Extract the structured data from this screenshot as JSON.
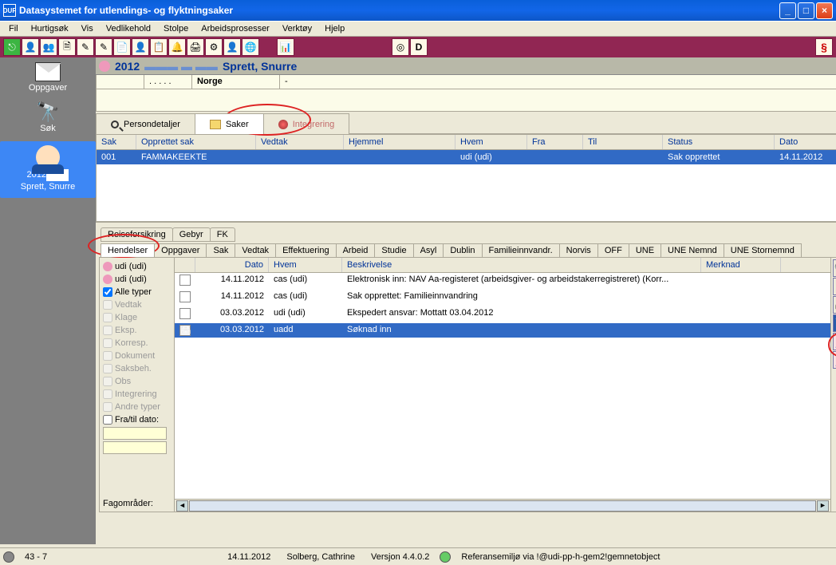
{
  "window": {
    "title": "Datasystemet for utlendings- og flyktningsaker",
    "minimize": "_",
    "maximize": "□",
    "close": "×"
  },
  "menu": {
    "fil": "Fil",
    "hurtigsok": "Hurtigsøk",
    "vis": "Vis",
    "vedlikehold": "Vedlikehold",
    "stolpe": "Stolpe",
    "arbeidsprosesser": "Arbeidsprosesser",
    "verktoy": "Verktøy",
    "hjelp": "Hjelp"
  },
  "toolbar_section": "§",
  "sidebar": {
    "oppgaver": "Oppgaver",
    "sok": "Søk",
    "card_prefix": "2012",
    "card_name": "Sprett, Snurre"
  },
  "header": {
    "title_name": "Sprett, Snurre",
    "title_year": "2012",
    "country": "Norge",
    "dash": "-"
  },
  "bigtabs": {
    "persondetaljer": "Persondetaljer",
    "saker": "Saker",
    "integrering": "Integrering"
  },
  "case_columns": {
    "sak": "Sak",
    "opprettet": "Opprettet sak",
    "vedtak": "Vedtak",
    "hjemmel": "Hjemmel",
    "hvem": "Hvem",
    "fra": "Fra",
    "til": "Til",
    "status": "Status",
    "dato": "Dato"
  },
  "case_row": {
    "sak": "001",
    "opprettet": "FAMMAKEEKTE",
    "vedtak": "",
    "hjemmel": "",
    "hvem": "udi (udi)",
    "fra": "",
    "til": "",
    "status": "Sak opprettet",
    "dato": "14.11.2012"
  },
  "subtabs1": {
    "reiseforsikring": "Reiseforsikring",
    "gebyr": "Gebyr",
    "fk": "FK"
  },
  "subtabs2": {
    "hendelser": "Hendelser",
    "oppgaver": "Oppgaver",
    "sak": "Sak",
    "vedtak": "Vedtak",
    "effektuering": "Effektuering",
    "arbeid": "Arbeid",
    "studie": "Studie",
    "asyl": "Asyl",
    "dublin": "Dublin",
    "familieinnv": "Familieinnvandr.",
    "norvis": "Norvis",
    "off": "OFF",
    "une": "UNE",
    "unenemnd": "UNE Nemnd",
    "unestornemnd": "UNE Stornemnd"
  },
  "hfilter": {
    "udi1": "udi (udi)",
    "udi2": "udi (udi)",
    "alle": "Alle typer",
    "vedtak": "Vedtak",
    "klage": "Klage",
    "eksp": "Eksp.",
    "korresp": "Korresp.",
    "dokument": "Dokument",
    "saksbeh": "Saksbeh.",
    "obs": "Obs",
    "integrering": "Integrering",
    "andre": "Andre typer",
    "fratil": "Fra/til dato:",
    "fagomrader": "Fagområder:"
  },
  "hgrid_head": {
    "dato": "Dato",
    "hvem": "Hvem",
    "beskrivelse": "Beskrivelse",
    "merknad": "Merknad"
  },
  "hrows": [
    {
      "dato": "14.11.2012",
      "hvem": "cas (udi)",
      "besk": "Elektronisk inn: NAV Aa-registeret (arbeidsgiver- og arbeidstakerregistreret) (Korr..."
    },
    {
      "dato": "14.11.2012",
      "hvem": "cas (udi)",
      "besk": "Sak opprettet: Familieinnvandring"
    },
    {
      "dato": "03.03.2012",
      "hvem": "udi (udi)",
      "besk": "Ekspedert ansvar: Mottatt 03.04.2012"
    },
    {
      "dato": "03.03.2012",
      "hvem": "uadd",
      "besk": "Søknad inn"
    }
  ],
  "status": {
    "coord": "43 - 7",
    "date": "14.11.2012",
    "user": "Solberg, Cathrine",
    "version": "Versjon 4.4.0.2",
    "ref": "Referansemiljø via !@udi-pp-h-gem2!gemnetobject"
  },
  "misc": {
    "word": "W",
    "dbtn": "D",
    "circ": "◎"
  }
}
